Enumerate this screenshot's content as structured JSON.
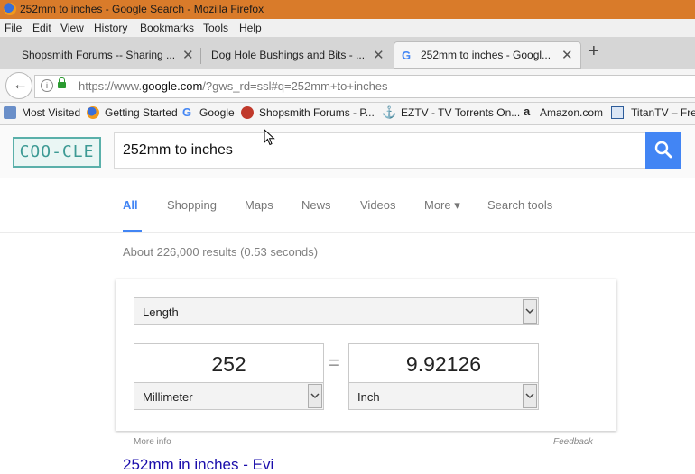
{
  "window": {
    "title": "252mm to inches - Google Search - Mozilla Firefox"
  },
  "menu": [
    "File",
    "Edit",
    "View",
    "History",
    "Bookmarks",
    "Tools",
    "Help"
  ],
  "tabs": [
    {
      "label": "Shopsmith Forums -- Sharing ...",
      "active": false
    },
    {
      "label": "Dog Hole Bushings and Bits - ...",
      "active": false
    },
    {
      "label": "252mm to inches - Googl...",
      "active": true
    }
  ],
  "new_tab_glyph": "+",
  "nav": {
    "back_glyph": "←",
    "url_prefix": "https://www.",
    "url_domain": "google.com",
    "url_rest": "/?gws_rd=ssl#q=252mm+to+inches"
  },
  "bookmarks": [
    "Most Visited",
    "Getting Started",
    "Google",
    "Shopsmith Forums - P...",
    "EZTV - TV Torrents On...",
    "Amazon.com",
    "TitanTV – Free"
  ],
  "google": {
    "logo_text": "COO-CLE",
    "query": "252mm to inches",
    "nav_tabs": [
      "All",
      "Shopping",
      "Maps",
      "News",
      "Videos",
      "More ▾",
      "Search tools"
    ],
    "active_tab": "All",
    "stats": "About 226,000 results (0.53 seconds)"
  },
  "converter": {
    "quantity": "Length",
    "from_value": "252",
    "from_unit": "Millimeter",
    "equals": "=",
    "to_value": "9.92126",
    "to_unit": "Inch"
  },
  "more_info": "More info",
  "feedback": "Feedback",
  "first_result": "252mm in inches - Evi",
  "colors": {
    "titlebar": "#d97b2a",
    "accent": "#4285f4",
    "link": "#1a0dab"
  }
}
